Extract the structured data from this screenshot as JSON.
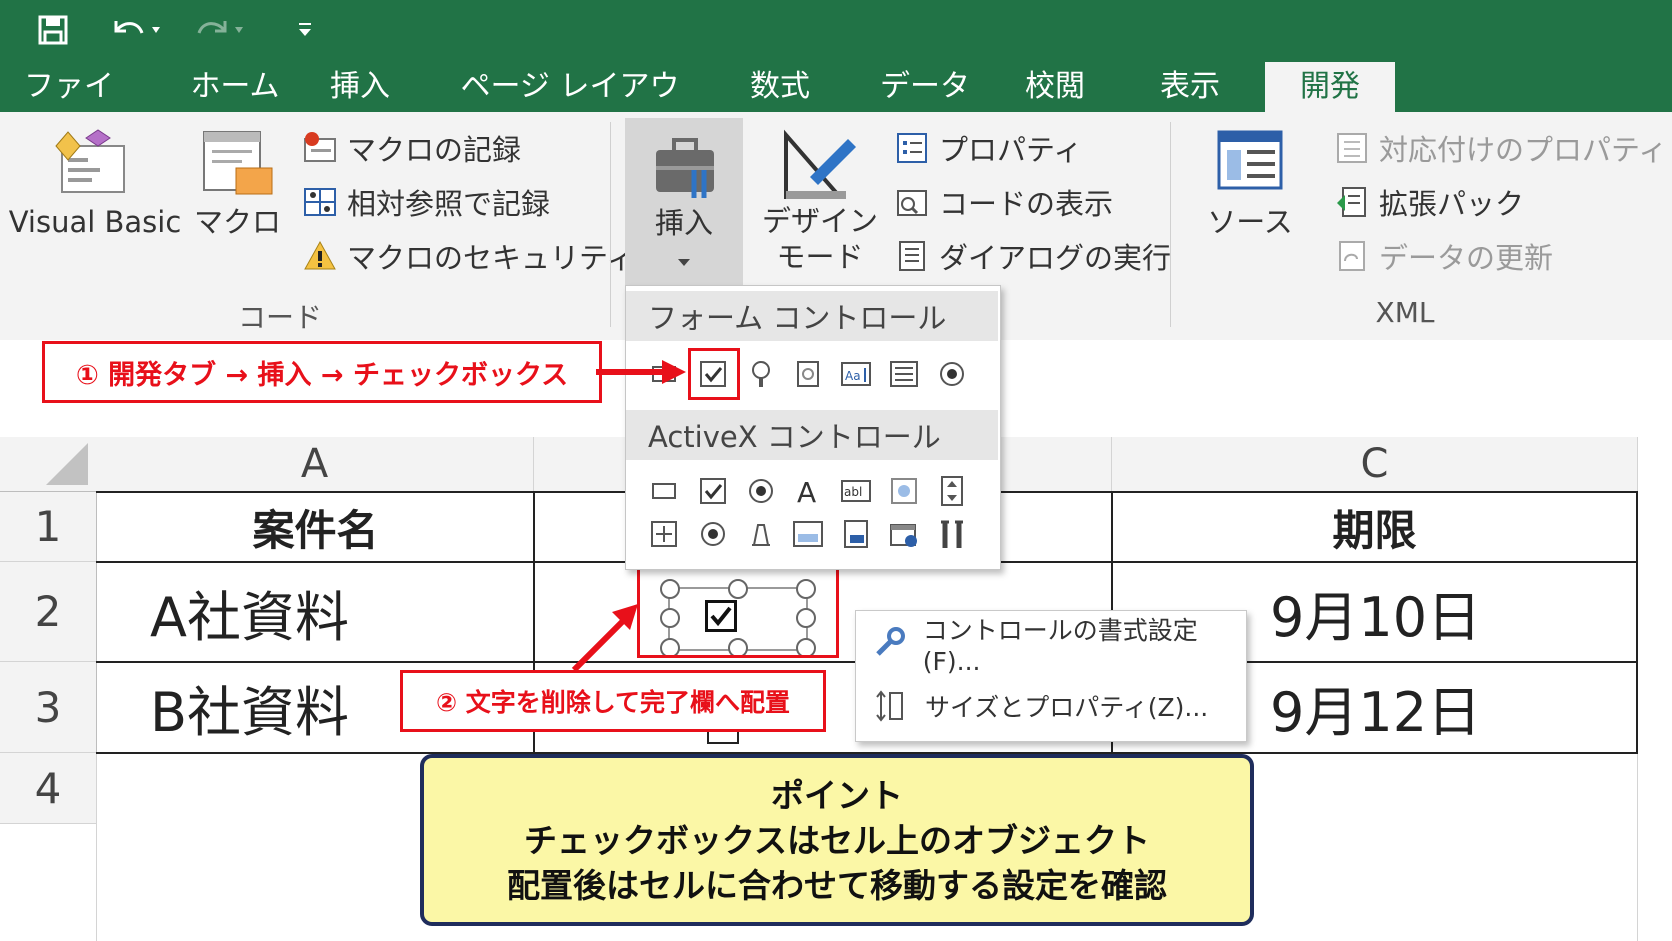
{
  "tabs": [
    "ファイル",
    "ホーム",
    "挿入",
    "ページ レイアウト",
    "数式",
    "データ",
    "校閲",
    "表示",
    "開発"
  ],
  "active_tab": "開発",
  "ribbon": {
    "code": {
      "visual_basic": "Visual Basic",
      "macro": "マクロ",
      "record_macro": "マクロの記録",
      "relative_ref": "相対参照で記録",
      "macro_security": "マクロのセキュリティ",
      "group_label": "コード"
    },
    "controls": {
      "insert": "挿入",
      "design_mode_1": "デザイン",
      "design_mode_2": "モード",
      "properties": "プロパティ",
      "view_code": "コードの表示",
      "run_dialog": "ダイアログの実行"
    },
    "xml": {
      "source": "ソース",
      "map_properties": "対応付けのプロパティ",
      "expansion_packs": "拡張パック",
      "refresh_data": "データの更新",
      "group_label": "XML"
    }
  },
  "dropdown": {
    "form_controls": "フォーム コントロール",
    "activex_controls": "ActiveX コントロール"
  },
  "grid": {
    "columns": [
      "A",
      "C"
    ],
    "rows": [
      "1",
      "2",
      "3",
      "4"
    ],
    "a1": "案件名",
    "c1": "期限",
    "a2": "A社資料",
    "c2": "9月10日",
    "a3": "B社資料",
    "c3": "9月12日"
  },
  "context_menu": {
    "format_control": "コントロールの書式設定(F)...",
    "size_properties": "サイズとプロパティ(Z)..."
  },
  "annotations": {
    "step1": "① 開発タブ → 挿入 → チェックボックス",
    "step2": "② 文字を削除して完了欄へ配置",
    "note_title": "ポイント",
    "note_line1": "チェックボックスはセル上のオブジェクト",
    "note_line2": "配置後はセルに合わせて移動する設定を確認"
  },
  "colors": {
    "excel_green": "#217346",
    "annotation_red": "#e8101a",
    "note_yellow": "#fbf7a6",
    "note_border": "#1f2d5c"
  }
}
